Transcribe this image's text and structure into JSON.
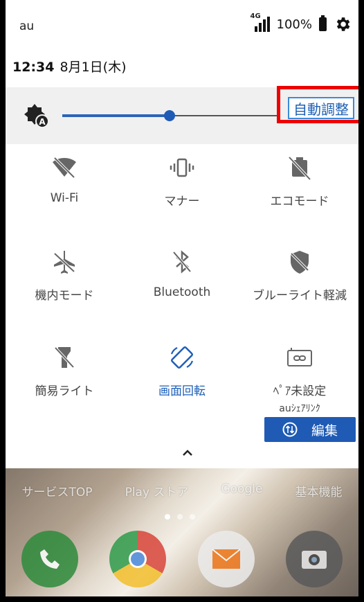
{
  "status": {
    "carrier": "au",
    "network": "4G",
    "battery_percent": "100%",
    "time": "12:34",
    "date": "8月1日(木)"
  },
  "brightness": {
    "level": 0.5,
    "auto_label": "自動調整"
  },
  "tiles": [
    {
      "label": "Wi-Fi",
      "icon": "wifi-off-icon",
      "active": false
    },
    {
      "label": "マナー",
      "icon": "vibrate-icon",
      "active": false
    },
    {
      "label": "エコモード",
      "icon": "eco-mode-icon",
      "active": false
    },
    {
      "label": "機内モード",
      "icon": "airplane-icon",
      "active": false
    },
    {
      "label": "Bluetooth",
      "icon": "bluetooth-off-icon",
      "active": false
    },
    {
      "label": "ブルーライト軽減",
      "icon": "blue-light-icon",
      "active": false
    },
    {
      "label": "簡易ライト",
      "icon": "flashlight-off-icon",
      "active": false
    },
    {
      "label": "画面回転",
      "icon": "rotate-icon",
      "active": true
    },
    {
      "label": "ﾍﾟｱ未設定",
      "sublabel": "auｼｪｱﾘﾝｸ",
      "icon": "share-link-icon",
      "active": false
    }
  ],
  "edit_label": "編集",
  "home": {
    "app_labels": [
      "サービスTOP",
      "Play ストア",
      "Google",
      "基本機能"
    ]
  },
  "colors": {
    "accent": "#1f5bb5",
    "highlight": "#ee0000"
  }
}
